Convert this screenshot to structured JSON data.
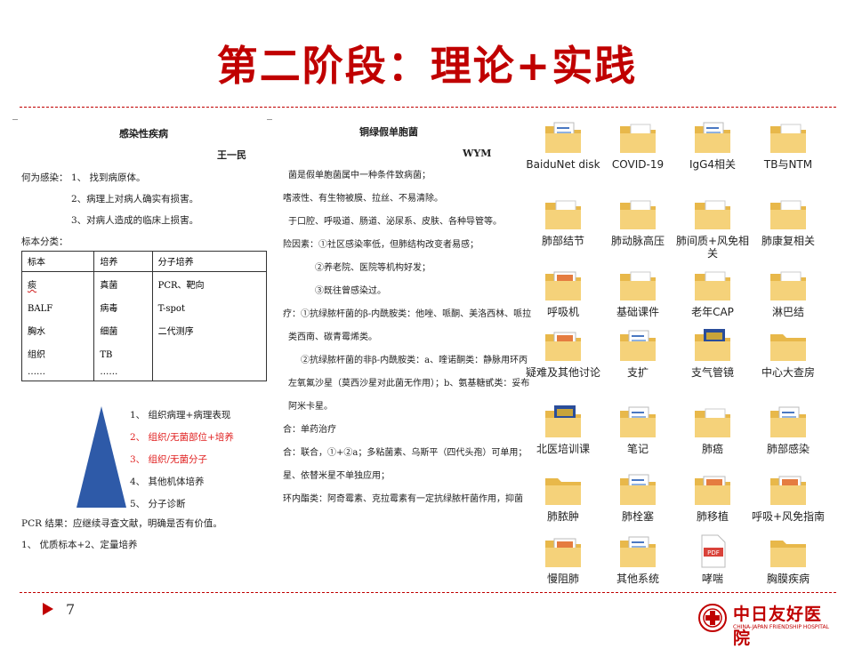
{
  "slide": {
    "title": "第二阶段：理论+实践",
    "page_number": "7",
    "accent_color": "#c00000"
  },
  "logo": {
    "name_cn": "中日友好医院",
    "name_en": "CHINA-JAPAN FRIENDSHIP HOSPITAL"
  },
  "doc_left": {
    "title": "感染性疾病",
    "author": "王一民",
    "what_is_infection_label": "何为感染：",
    "what_is_infection": [
      "1、 找到病原体。",
      "2、病理上对病人确实有损害。",
      "3、对病人造成的临床上损害。"
    ],
    "specimen_label": "标本分类：",
    "table_headers": [
      "标本",
      "培养",
      "分子培养"
    ],
    "table_cols": [
      [
        "痰",
        "BALF",
        "胸水",
        "组织",
        "……"
      ],
      [
        "真菌",
        "病毒",
        "细菌",
        "TB",
        "……"
      ],
      [
        "PCR、靶向",
        "T-spot",
        "二代测序"
      ]
    ],
    "pyramid_items": [
      {
        "text": "1、  组织病理+病理表现",
        "color": "#222222"
      },
      {
        "text": "2、  组织/无菌部位+培养",
        "color": "#e02020"
      },
      {
        "text": "3、  组织/无菌分子",
        "color": "#e02020"
      },
      {
        "text": "4、  其他机体培养",
        "color": "#222222"
      },
      {
        "text": "5、  分子诊断",
        "color": "#222222"
      }
    ],
    "pcr_result": "PCR 结果：应继续寻查文献，明确是否有价值。",
    "footer_line": "1、  优质标本+2、定量培养"
  },
  "doc_right": {
    "title": "铜绿假单胞菌",
    "author": "WYM",
    "lines": [
      "菌是假单胞菌属中一种条件致病菌；",
      "嗜液性、有生物被膜、拉丝、不易清除。",
      "于口腔、呼吸道、肠道、泌尿系、皮肤、各种导管等。",
      "险因素：①社区感染率低，但肺结构改变者易感；",
      "②养老院、医院等机构好发；",
      "③既往曾感染过。",
      "疗：①抗绿脓杆菌的β-内酰胺类：他唑、哌酮、美洛西林、哌拉",
      "类西南、碳青霉烯类。",
      "②抗绿脓杆菌的非β-内酰胺类：a、喹诺酮类：静脉用环丙",
      "左氧氟沙星（莫西沙星对此菌无作用）；b、氨基糖甙类：妥布",
      "阿米卡星。",
      "合：单药治疗",
      "合：联合，①+②a；多粘菌素、乌斯平（四代头孢）可单用；",
      "星、依替米星不单独应用；",
      "环内酯类：阿奇霉素、克拉霉素有一定抗绿脓杆菌作用，抑菌"
    ]
  },
  "folders": [
    {
      "label": "BaiduNet disk",
      "icon": "folder-files-icon"
    },
    {
      "label": "COVID-19",
      "icon": "folder-pdf-icon"
    },
    {
      "label": "IgG4相关",
      "icon": "folder-files-icon"
    },
    {
      "label": "TB与NTM",
      "icon": "folder-pdf-icon"
    },
    {
      "label": "肺部结节",
      "icon": "folder-pdf-icon"
    },
    {
      "label": "肺动脉高压",
      "icon": "folder-pdf-icon"
    },
    {
      "label": "肺间质+风免相关",
      "icon": "folder-pdf-icon"
    },
    {
      "label": "肺康复相关",
      "icon": "folder-pdf-icon"
    },
    {
      "label": "呼吸机",
      "icon": "folder-slides-icon"
    },
    {
      "label": "基础课件",
      "icon": "folder-pdf-icon"
    },
    {
      "label": "老年CAP",
      "icon": "folder-pdf-icon"
    },
    {
      "label": "淋巴结",
      "icon": "folder-pdf-icon"
    },
    {
      "label": "疑难及其他讨论",
      "icon": "folder-slides-icon"
    },
    {
      "label": "支扩",
      "icon": "folder-files-icon"
    },
    {
      "label": "支气管镜",
      "icon": "folder-book-icon"
    },
    {
      "label": "中心大查房",
      "icon": "folder-empty-icon"
    },
    {
      "label": "北医培训课",
      "icon": "folder-book-icon"
    },
    {
      "label": "笔记",
      "icon": "folder-files-icon"
    },
    {
      "label": "肺癌",
      "icon": "folder-pdf-icon"
    },
    {
      "label": "肺部感染",
      "icon": "folder-files-icon"
    },
    {
      "label": "肺脓肿",
      "icon": "folder-empty-icon"
    },
    {
      "label": "肺栓塞",
      "icon": "folder-files-icon"
    },
    {
      "label": "肺移植",
      "icon": "folder-slides-icon"
    },
    {
      "label": "呼吸+风免指南",
      "icon": "folder-slides-icon"
    },
    {
      "label": "慢阻肺",
      "icon": "folder-slides-icon"
    },
    {
      "label": "其他系统",
      "icon": "folder-files-icon"
    },
    {
      "label": "哮喘",
      "icon": "pdf-file-icon"
    },
    {
      "label": "胸膜疾病",
      "icon": "folder-empty-icon"
    }
  ]
}
